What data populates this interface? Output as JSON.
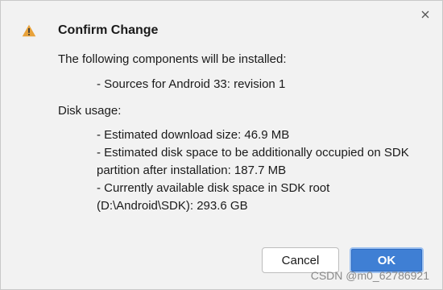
{
  "dialog": {
    "title": "Confirm Change",
    "intro": "The following components will be installed:",
    "components": [
      "- Sources for Android 33: revision 1"
    ],
    "disk_usage_label": "Disk usage:",
    "disk_lines": [
      "- Estimated download size: 46.9 MB",
      "- Estimated disk space to be additionally occupied on SDK partition after installation: 187.7 MB",
      "- Currently available disk space in SDK root (D:\\Android\\SDK): 293.6 GB"
    ],
    "buttons": {
      "cancel": "Cancel",
      "ok": "OK"
    },
    "icons": {
      "warning": "warning-triangle-icon",
      "close": "close-icon"
    },
    "colors": {
      "warning": "#e8a23a",
      "primary": "#3f7fd4"
    }
  },
  "watermark": "CSDN @m0_62786921"
}
